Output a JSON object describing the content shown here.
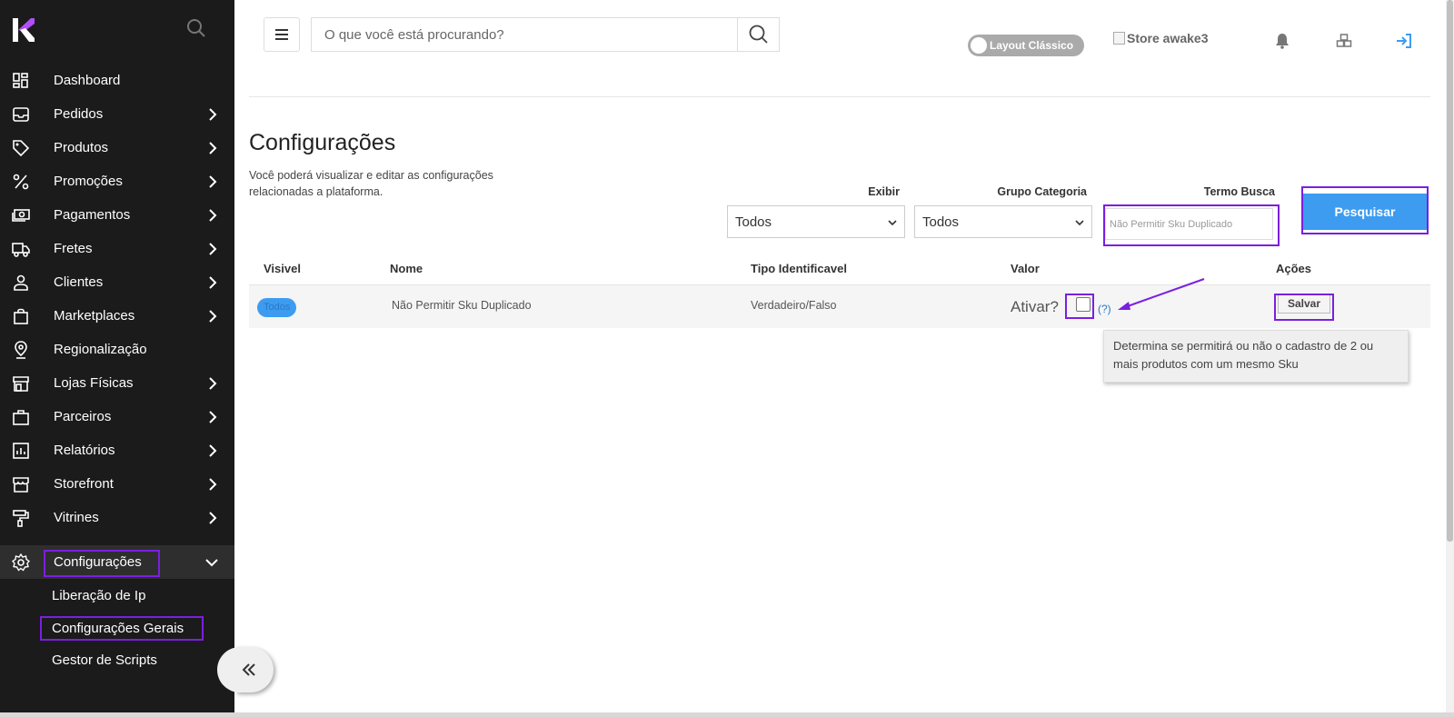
{
  "sidebar": {
    "items": [
      {
        "label": "Dashboard",
        "icon": "dashboard-icon"
      },
      {
        "label": "Pedidos",
        "icon": "inbox-icon"
      },
      {
        "label": "Produtos",
        "icon": "tag-icon"
      },
      {
        "label": "Promoções",
        "icon": "percent-icon"
      },
      {
        "label": "Pagamentos",
        "icon": "money-icon"
      },
      {
        "label": "Fretes",
        "icon": "truck-icon"
      },
      {
        "label": "Clientes",
        "icon": "user-icon"
      },
      {
        "label": "Marketplaces",
        "icon": "shopping-bag-icon"
      },
      {
        "label": "Regionalização",
        "icon": "location-pin-icon"
      },
      {
        "label": "Lojas Físicas",
        "icon": "store-icon"
      },
      {
        "label": "Parceiros",
        "icon": "briefcase-icon"
      },
      {
        "label": "Relatórios",
        "icon": "report-icon"
      },
      {
        "label": "Storefront",
        "icon": "storefront-icon"
      },
      {
        "label": "Vitrines",
        "icon": "paint-roller-icon"
      },
      {
        "label": "Configurações",
        "icon": "gear-icon"
      }
    ],
    "subitems": [
      {
        "label": "Liberação de Ip"
      },
      {
        "label": "Configurações Gerais"
      },
      {
        "label": "Gestor de Scripts"
      }
    ]
  },
  "topbar": {
    "search_placeholder": "O que você está procurando?",
    "toggle_label": "Layout Clássico",
    "store_alt": "Store awake3"
  },
  "page": {
    "title": "Configurações",
    "description": "Você poderá visualizar e editar as configurações relacionadas a plataforma."
  },
  "filters": {
    "exibir_label": "Exibir",
    "exibir_value": "Todos",
    "grupo_label": "Grupo Categoria",
    "grupo_value": "Todos",
    "termo_label": "Termo Busca",
    "termo_placeholder": "Não Permitir Sku Duplicado",
    "search_button": "Pesquisar"
  },
  "table": {
    "headers": [
      "Visivel",
      "Nome",
      "Tipo Identificavel",
      "Valor",
      "Ações"
    ],
    "rows": [
      {
        "visivel": "Todos",
        "nome": "Não Permitir Sku Duplicado",
        "tipo": "Verdadeiro/Falso",
        "valor_label": "Ativar?",
        "help": "(?)",
        "action": "Salvar"
      }
    ]
  },
  "tooltip": {
    "text": "Determina se permitirá ou não o cadastro de 2 ou mais produtos com um mesmo Sku"
  },
  "colors": {
    "sidebar_bg": "#1b1b1b",
    "accent_blue": "#3d9cf0",
    "highlight_purple": "#7b1fe0",
    "logo_purple": "#b14ef5"
  }
}
